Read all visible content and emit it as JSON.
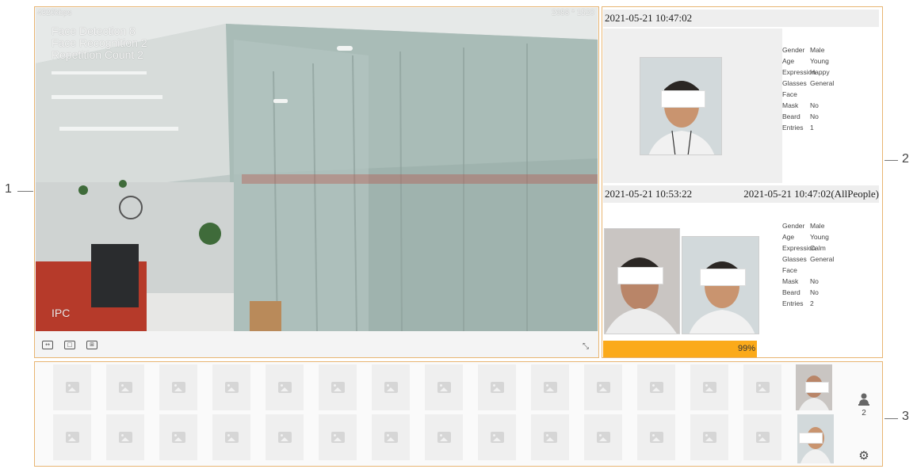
{
  "callouts": {
    "left": "1",
    "right_top": "2",
    "right_bottom": "3"
  },
  "live_view": {
    "bitrate": "4320kbps",
    "resolution": "2688 * 1520",
    "stats": [
      "Face Detection  8",
      "Face Recognition  2",
      "Repetition Count  2"
    ],
    "camera_label": "IPC",
    "toolbar": {
      "icons": [
        "fit-window-icon",
        "original-size-icon",
        "region-zoom-icon"
      ],
      "fullscreen_icon": "fullscreen-icon"
    }
  },
  "face_records": {
    "record1": {
      "time": "2021-05-21 10:47:02",
      "attributes": [
        {
          "k": "Gender",
          "v": "Male"
        },
        {
          "k": "Age",
          "v": "Young"
        },
        {
          "k": "Expression",
          "v": "Happy"
        },
        {
          "k": "Glasses",
          "v": "General"
        },
        {
          "k": "Face Mask",
          "v": "No"
        },
        {
          "k": "Beard",
          "v": "No"
        },
        {
          "k": "Entries",
          "v": "1"
        }
      ]
    },
    "record2": {
      "time": "2021-05-21 10:53:22",
      "match_time": "2021-05-21 10:47:02(AllPeople)",
      "attributes": [
        {
          "k": "Gender",
          "v": "Male"
        },
        {
          "k": "Age",
          "v": "Young"
        },
        {
          "k": "Expression",
          "v": "Calm"
        },
        {
          "k": "Glasses",
          "v": "General"
        },
        {
          "k": "Face Mask",
          "v": "No"
        },
        {
          "k": "Beard",
          "v": "No"
        },
        {
          "k": "Entries",
          "v": "2"
        }
      ],
      "similarity_label": "99%",
      "similarity": 0.99
    }
  },
  "strip": {
    "person_count": "2",
    "empty_slots_per_row": 14,
    "rows": 2
  },
  "colors": {
    "border": "#e8b572",
    "progress": "#fbaa1a"
  }
}
